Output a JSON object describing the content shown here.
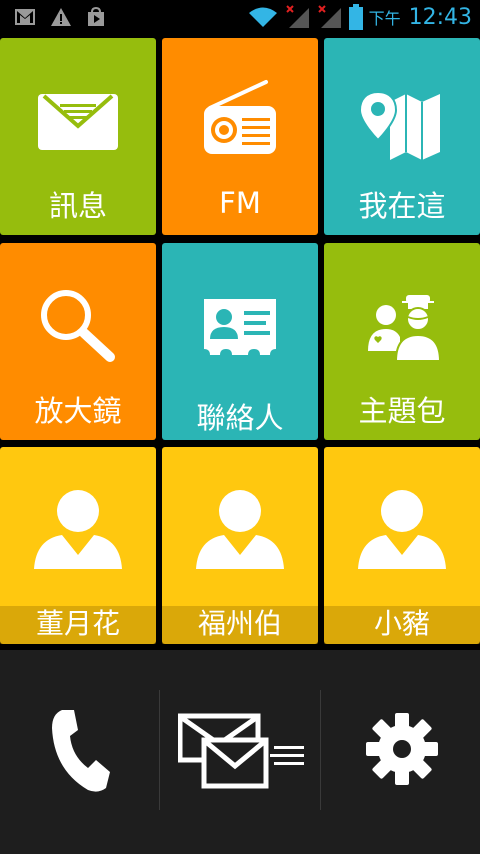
{
  "status_bar": {
    "ampm": "下午",
    "time": "12:43",
    "icons": [
      "gmail-icon",
      "warning-icon",
      "play-store-icon",
      "wifi-icon",
      "signal-icon",
      "signal-icon",
      "battery-icon"
    ]
  },
  "tiles": [
    {
      "label": "訊息",
      "icon": "envelope-icon",
      "color": "#96bd0d"
    },
    {
      "label": "FM",
      "icon": "radio-icon",
      "color": "#ff8c00"
    },
    {
      "label": "我在這",
      "icon": "map-pin-icon",
      "color": "#2bb5b5"
    },
    {
      "label": "放大鏡",
      "icon": "magnifier-icon",
      "color": "#ff8c00"
    },
    {
      "label": "聯絡人",
      "icon": "contact-card-icon",
      "color": "#2bb5b5"
    },
    {
      "label": "主題包",
      "icon": "theme-people-icon",
      "color": "#96bd0d"
    }
  ],
  "contacts": [
    {
      "name": "董月花",
      "icon": "person-icon",
      "color": "#ffc80f"
    },
    {
      "name": "福州伯",
      "icon": "person-icon",
      "color": "#ffc80f"
    },
    {
      "name": "小豬",
      "icon": "person-icon",
      "color": "#ffc80f"
    }
  ],
  "dock": {
    "items": [
      "phone-icon",
      "messages-icon",
      "settings-gear-icon"
    ]
  }
}
